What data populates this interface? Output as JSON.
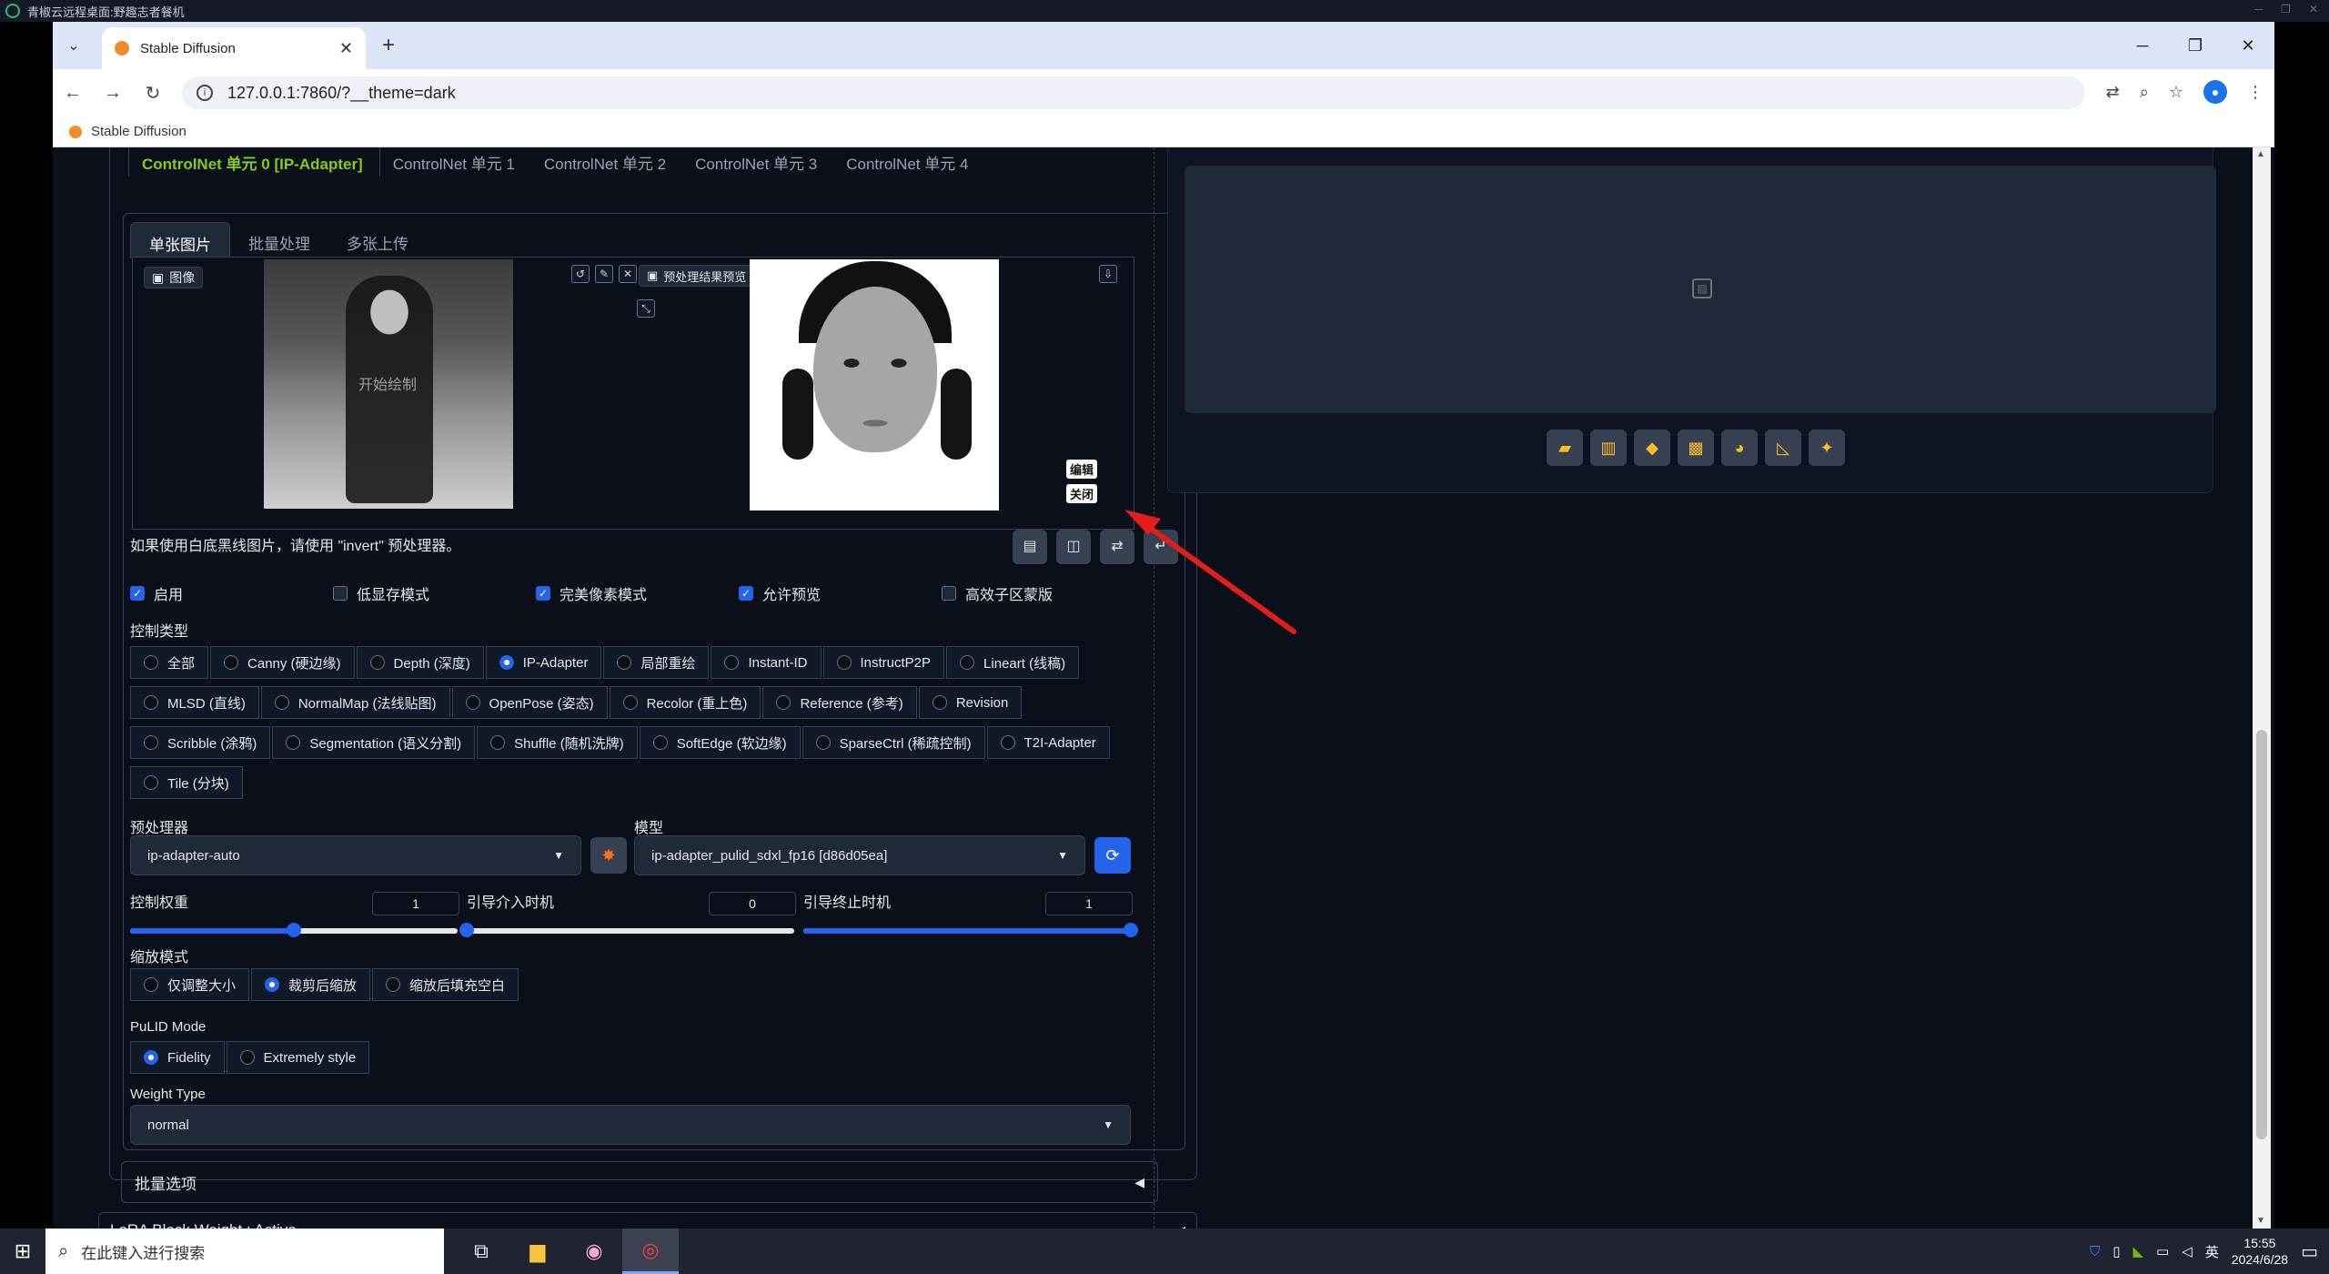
{
  "remote": {
    "title": "青椒云远程桌面:野趣志者餐机"
  },
  "browser": {
    "tab_title": "Stable Diffusion",
    "url": "127.0.0.1:7860/?__theme=dark",
    "bookmark": "Stable Diffusion"
  },
  "controlnet": {
    "unit_tabs": [
      "ControlNet 单元 0 [IP-Adapter]",
      "ControlNet 单元 1",
      "ControlNet 单元 2",
      "ControlNet 单元 3",
      "ControlNet 单元 4"
    ],
    "image_tabs": [
      "单张图片",
      "批量处理",
      "多张上传"
    ],
    "image_label": "图像",
    "watermark": "开始绘制",
    "preview_label": "预处理结果预览",
    "edit_badge": "编辑",
    "close_badge": "关闭",
    "hint": "如果使用白底黑线图片，请使用 \"invert\" 预处理器。",
    "checkboxes": [
      {
        "label": "启用",
        "checked": true
      },
      {
        "label": "低显存模式",
        "checked": false
      },
      {
        "label": "完美像素模式",
        "checked": true
      },
      {
        "label": "允许预览",
        "checked": true
      },
      {
        "label": "高效子区蒙版",
        "checked": false
      }
    ],
    "control_type_label": "控制类型",
    "control_types": [
      [
        "全部",
        "Canny (硬边缘)",
        "Depth (深度)",
        "IP-Adapter",
        "局部重绘",
        "Instant-ID",
        "InstructP2P",
        "Lineart (线稿)"
      ],
      [
        "MLSD (直线)",
        "NormalMap (法线贴图)",
        "OpenPose (姿态)",
        "Recolor (重上色)",
        "Reference (参考)",
        "Revision"
      ],
      [
        "Scribble (涂鸦)",
        "Segmentation (语义分割)",
        "Shuffle (随机洗牌)",
        "SoftEdge (软边缘)",
        "SparseCtrl (稀疏控制)",
        "T2I-Adapter"
      ],
      [
        "Tile (分块)"
      ]
    ],
    "selected_type": "IP-Adapter",
    "preprocessor_label": "预处理器",
    "preprocessor": "ip-adapter-auto",
    "model_label": "模型",
    "model": "ip-adapter_pulid_sdxl_fp16 [d86d05ea]",
    "weight_label": "控制权重",
    "weight": "1",
    "start_label": "引导介入时机",
    "start": "0",
    "end_label": "引导终止时机",
    "end": "1",
    "resize_label": "缩放模式",
    "resize_modes": [
      "仅调整大小",
      "裁剪后缩放",
      "缩放后填充空白"
    ],
    "resize_selected": "裁剪后缩放",
    "pulid_label": "PuLID Mode",
    "pulid_modes": [
      "Fidelity",
      "Extremely style"
    ],
    "pulid_selected": "Fidelity",
    "weight_type_label": "Weight Type",
    "weight_type": "normal",
    "batch_options": "批量选项",
    "lora": "LoRA Block Weight : Active"
  },
  "taskbar": {
    "search_placeholder": "在此键入进行搜索",
    "time": "15:55",
    "date": "2024/6/28",
    "ime": "英"
  }
}
